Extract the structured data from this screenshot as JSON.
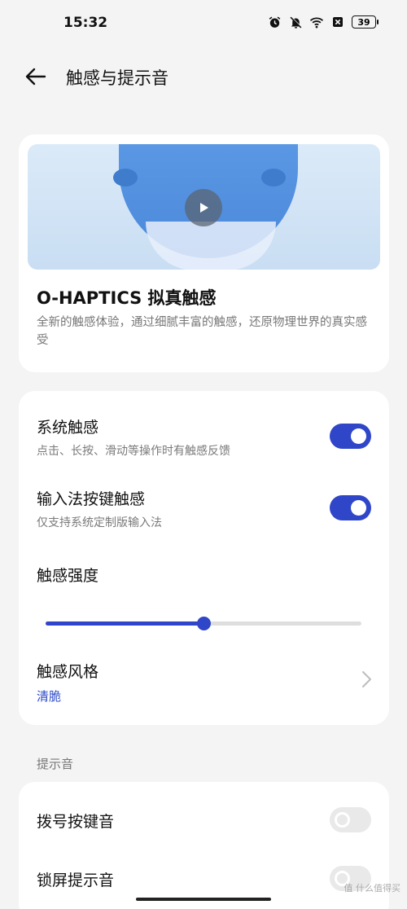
{
  "status_bar": {
    "time": "15:32",
    "battery": "39",
    "icons": [
      "alarm-icon",
      "mute-icon",
      "wifi-icon",
      "no-sim-icon",
      "battery-icon"
    ]
  },
  "header": {
    "title": "触感与提示音"
  },
  "hero": {
    "title": "O-HAPTICS 拟真触感",
    "description": "全新的触感体验，通过细腻丰富的触感，还原物理世界的真实感受"
  },
  "settings": {
    "system_haptics": {
      "title": "系统触感",
      "subtitle": "点击、长按、滑动等操作时有触感反馈",
      "enabled": true
    },
    "ime_haptics": {
      "title": "输入法按键触感",
      "subtitle": "仅支持系统定制版输入法",
      "enabled": true
    },
    "intensity": {
      "title": "触感强度",
      "level": 0.5
    },
    "style": {
      "title": "触感风格",
      "value": "清脆"
    }
  },
  "sounds": {
    "section_label": "提示音",
    "dial_keypad": {
      "title": "拨号按键音",
      "enabled": false
    },
    "lock_sound": {
      "title": "锁屏提示音",
      "enabled": false
    }
  },
  "watermark": "值 什么值得买",
  "colors": {
    "accent": "#2f46c8",
    "background": "#f4f4f4",
    "card": "#ffffff"
  }
}
